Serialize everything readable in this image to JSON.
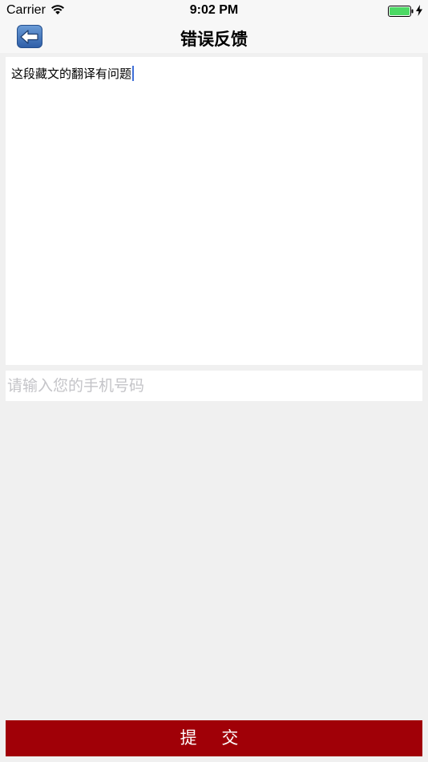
{
  "status_bar": {
    "carrier": "Carrier",
    "time": "9:02 PM",
    "battery_color": "#4cd964"
  },
  "nav": {
    "title": "错误反馈",
    "back_icon": "back-arrow-icon"
  },
  "feedback": {
    "value": "这段藏文的翻译有问题"
  },
  "phone": {
    "value": "",
    "placeholder": "请输入您的手机号码"
  },
  "submit": {
    "label": "提 交",
    "color": "#a00007"
  }
}
